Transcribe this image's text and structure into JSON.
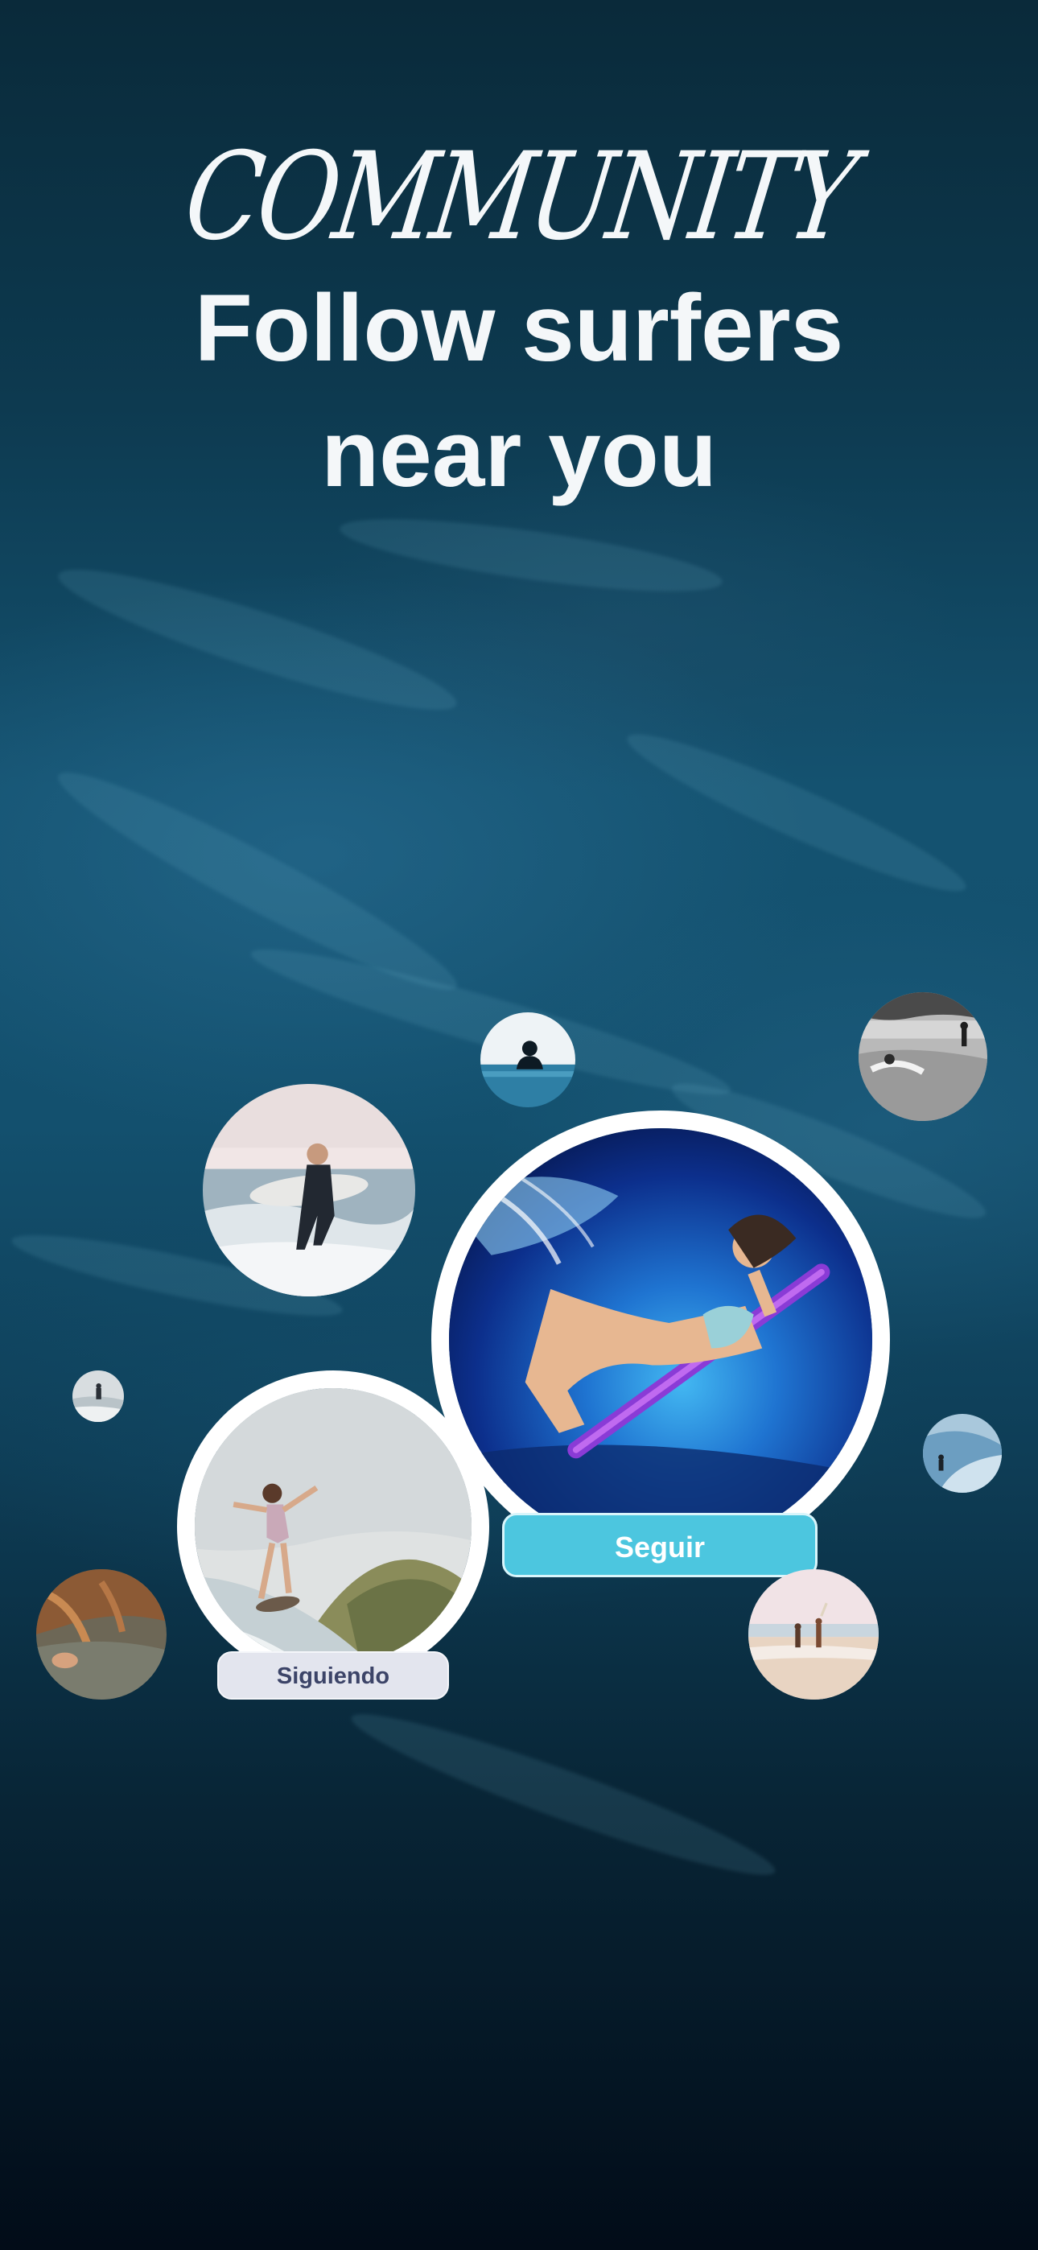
{
  "header": {
    "kicker": "COMMUNITY",
    "title_line1": "Follow surfers",
    "title_line2": "near you"
  },
  "actions": {
    "follow_label": "Seguir",
    "following_label": "Siguiendo"
  },
  "colors": {
    "follow_button": "#4cc6df",
    "following_button": "#e3e5ee",
    "following_text": "#3c4468",
    "headline_text": "#f4f7f9",
    "ring": "#ffffff"
  },
  "profiles": [
    {
      "name": "surfer-underwater-purple-board",
      "state": "follow"
    },
    {
      "name": "surfer-riding-wave",
      "state": "following"
    },
    {
      "name": "surfer-carrying-board-in-wetsuit"
    },
    {
      "name": "surfer-silhouette-in-water"
    },
    {
      "name": "black-and-white-beach-surfers"
    },
    {
      "name": "small-surfer-on-wave"
    },
    {
      "name": "surfer-on-blue-wave"
    },
    {
      "name": "close-up-hand-on-board"
    },
    {
      "name": "two-people-on-beach"
    }
  ]
}
